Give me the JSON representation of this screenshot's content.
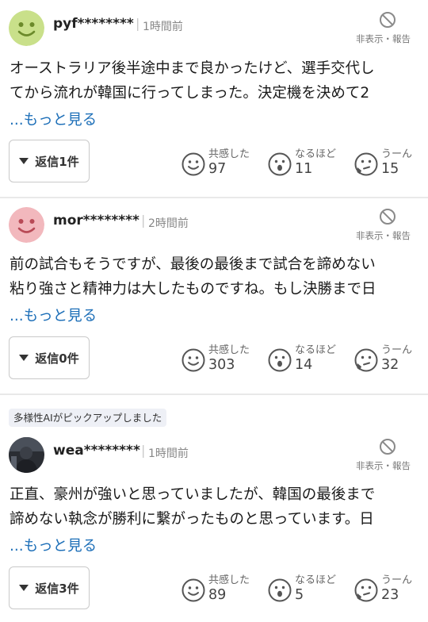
{
  "hide_label": "非表示・報告",
  "more_label": "...もっと見る",
  "reactions": {
    "agree_label": "共感した",
    "insight_label": "なるほど",
    "hmm_label": "うーん"
  },
  "colors": {
    "link": "#1d6fb8",
    "avatar_green": "#c9e08a",
    "avatar_pink": "#f2b8bd",
    "badge_bg": "#eef0f6"
  },
  "comments": [
    {
      "user": "pyf********",
      "time": "1時間前",
      "avatar": "smile-green",
      "line1": "オーストラリア後半途中まで良かったけど、選手交代し",
      "line2": "てから流れが韓国に行ってしまった。決定機を決めて2",
      "reply": "返信1件",
      "agree": "97",
      "insight": "11",
      "hmm": "15"
    },
    {
      "user": "mor********",
      "time": "2時間前",
      "avatar": "smile-pink",
      "line1": "前の試合もそうですが、最後の最後まで試合を諦めない",
      "line2": "粘り強さと精神力は大したものですね。もし決勝まで日",
      "reply": "返信0件",
      "agree": "303",
      "insight": "14",
      "hmm": "32"
    },
    {
      "badge": "多様性AIがピックアップしました",
      "user": "wea********",
      "time": "1時間前",
      "avatar": "photo",
      "line1": "正直、豪州が強いと思っていましたが、韓国の最後まで",
      "line2": "諦めない執念が勝利に繋がったものと思っています。日",
      "reply": "返信3件",
      "agree": "89",
      "insight": "5",
      "hmm": "23"
    }
  ]
}
